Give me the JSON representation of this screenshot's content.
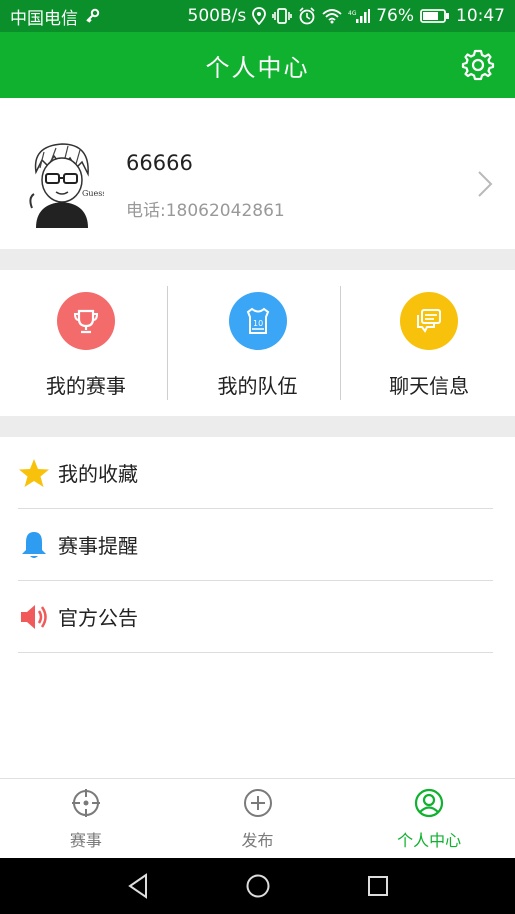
{
  "status_bar": {
    "carrier": "中国电信",
    "speed": "500B/s",
    "battery_pct": "76%",
    "time": "10:47",
    "icons": [
      "key-icon",
      "location-icon",
      "vibrate-icon",
      "alarm-icon",
      "wifi-icon",
      "signal-icon",
      "battery-icon"
    ]
  },
  "header": {
    "title": "个人中心",
    "settings_icon": "gear-icon"
  },
  "profile": {
    "name": "66666",
    "phone": "电话:18062042861"
  },
  "quick": [
    {
      "label": "我的赛事",
      "icon": "trophy-icon",
      "color": "#f36b6b"
    },
    {
      "label": "我的队伍",
      "icon": "jersey-icon",
      "color": "#3aa6f5"
    },
    {
      "label": "聊天信息",
      "icon": "chat-icon",
      "color": "#f8c20c"
    }
  ],
  "list": [
    {
      "label": "我的收藏",
      "icon": "star-icon"
    },
    {
      "label": "赛事提醒",
      "icon": "bell-icon"
    },
    {
      "label": "官方公告",
      "icon": "speaker-icon"
    }
  ],
  "tabs": [
    {
      "label": "赛事",
      "icon": "target-icon",
      "active": false
    },
    {
      "label": "发布",
      "icon": "plus-circle-icon",
      "active": false
    },
    {
      "label": "个人中心",
      "icon": "user-circle-icon",
      "active": true
    }
  ],
  "colors": {
    "primary": "#0fb12e",
    "status_bar": "#0a8f2b"
  }
}
